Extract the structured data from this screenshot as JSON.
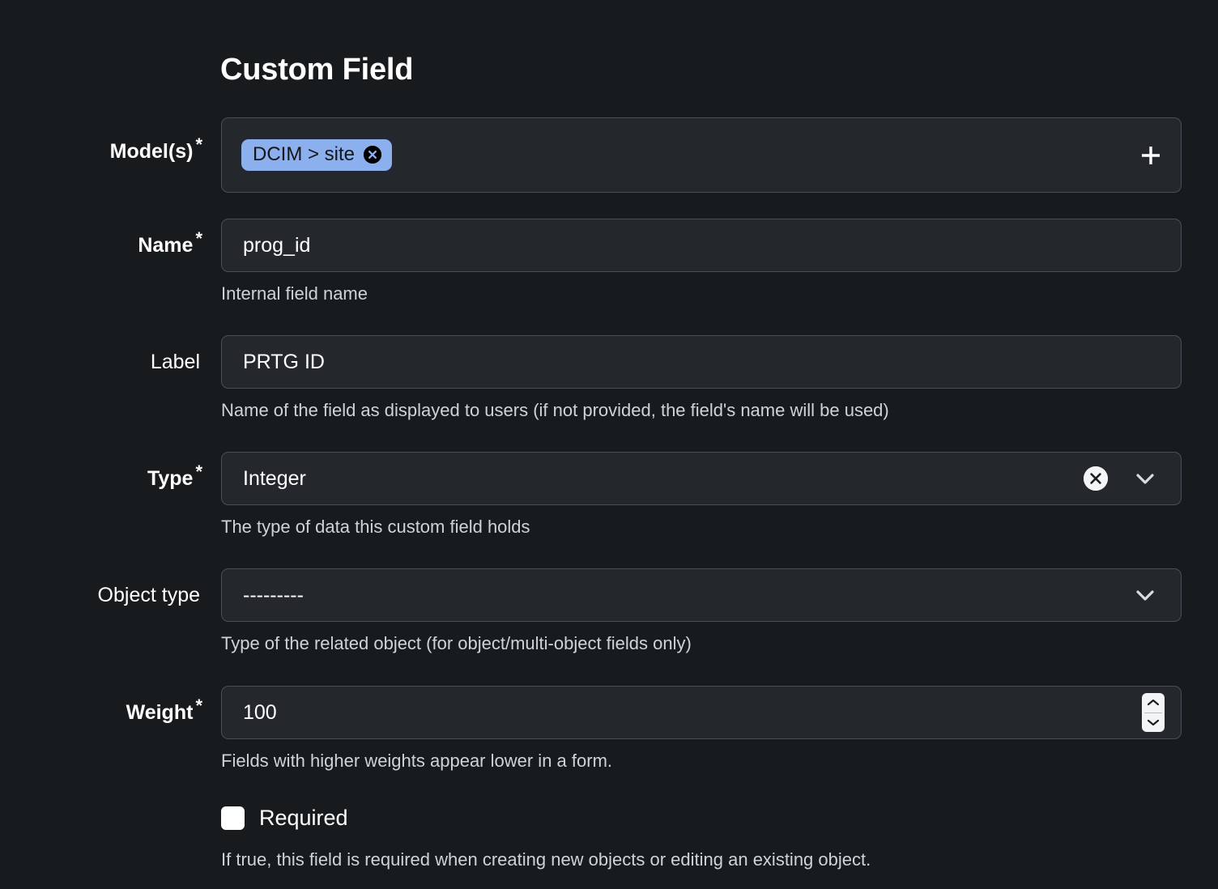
{
  "page": {
    "title": "Custom Field"
  },
  "fields": {
    "models": {
      "label": "Model(s)",
      "required_marker": "*",
      "tags": [
        {
          "text": "DCIM > site",
          "remove_icon": "circle-x-icon"
        }
      ],
      "add_icon": "plus-icon",
      "help": ""
    },
    "name": {
      "label": "Name",
      "required_marker": "*",
      "value": "prog_id",
      "help": "Internal field name"
    },
    "field_label": {
      "label": "Label",
      "required_marker": "",
      "value": "PRTG ID",
      "help": "Name of the field as displayed to users (if not provided, the field's name will be used)"
    },
    "type": {
      "label": "Type",
      "required_marker": "*",
      "value": "Integer",
      "clear_icon": "circle-x-icon",
      "dropdown_icon": "chevron-down-icon",
      "help": "The type of data this custom field holds"
    },
    "object_type": {
      "label": "Object type",
      "required_marker": "",
      "value": "---------",
      "dropdown_icon": "chevron-down-icon",
      "help": "Type of the related object (for object/multi-object fields only)"
    },
    "weight": {
      "label": "Weight",
      "required_marker": "*",
      "value": "100",
      "spinner_icon": "number-spinner-icon",
      "help": "Fields with higher weights appear lower in a form."
    },
    "required": {
      "label": "Required",
      "checked": false,
      "help": "If true, this field is required when creating new objects or editing an existing object."
    }
  },
  "colors": {
    "background": "#181b1e",
    "control_background": "#24272c",
    "control_border": "#4a4f57",
    "tag_background": "#8cafee",
    "text_primary": "#ffffff",
    "text_help": "#cfd3d8"
  }
}
